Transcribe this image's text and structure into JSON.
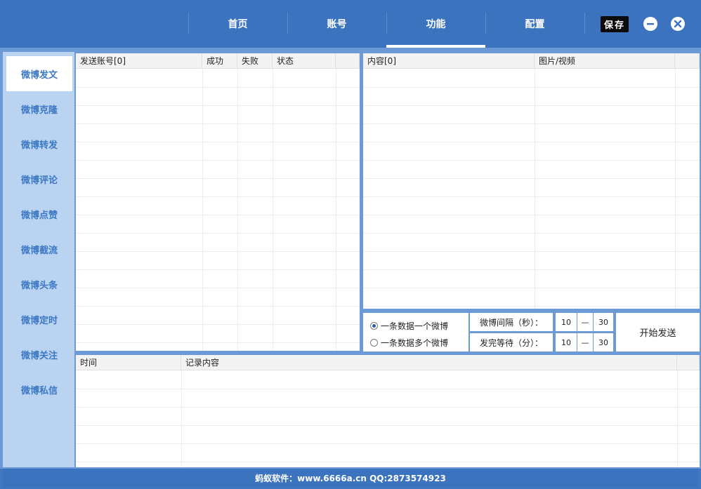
{
  "nav": {
    "tabs": [
      {
        "label": "首页"
      },
      {
        "label": "账号"
      },
      {
        "label": "功能"
      },
      {
        "label": "配置"
      }
    ],
    "active_index": 2,
    "save_label": "保存"
  },
  "window_controls": {
    "minimize_icon": "minus-circle",
    "close_icon": "x-circle"
  },
  "sidebar": {
    "items": [
      {
        "label": "微博发文"
      },
      {
        "label": "微博克隆"
      },
      {
        "label": "微博转发"
      },
      {
        "label": "微博评论"
      },
      {
        "label": "微博点赞"
      },
      {
        "label": "微博截流"
      },
      {
        "label": "微博头条"
      },
      {
        "label": "微博定时"
      },
      {
        "label": "微博关注"
      },
      {
        "label": "微博私信"
      }
    ],
    "active_index": 0
  },
  "accounts_table": {
    "columns": [
      "发送账号[0]",
      "成功",
      "失败",
      "状态",
      ""
    ],
    "rows": []
  },
  "content_table": {
    "columns": [
      "内容[0]",
      "图片/视频",
      ""
    ],
    "rows": []
  },
  "log_table": {
    "columns": [
      "时间",
      "记录内容",
      ""
    ],
    "rows": []
  },
  "settings": {
    "mode_options": [
      {
        "label": "一条数据一个微博",
        "selected": true
      },
      {
        "label": "一条数据多个微博",
        "selected": false
      }
    ],
    "interval_label": "微博间隔（秒）：",
    "interval_min": "10",
    "interval_max": "30",
    "wait_label": "发完等待（分）：",
    "wait_min": "10",
    "wait_max": "30",
    "range_separator": "—",
    "start_label": "开始发送"
  },
  "footer": {
    "text": "蚂蚁软件：www.6666a.cn QQ:2873574923"
  },
  "colors": {
    "header_bg": "#3c73bf",
    "frame_bg": "#6b9ad6",
    "sidebar_bg": "#b9d3f1",
    "sidebar_text": "#3b78c4"
  }
}
